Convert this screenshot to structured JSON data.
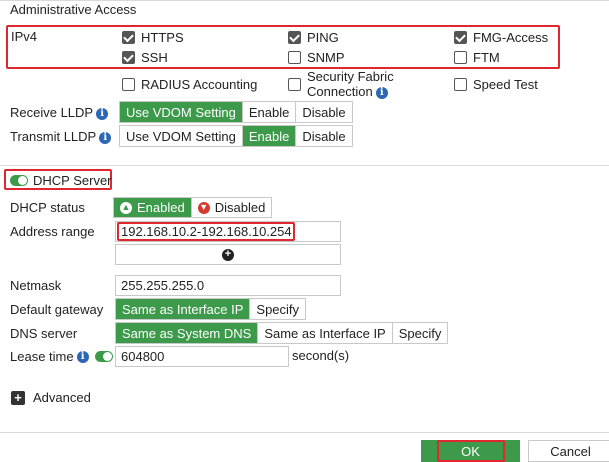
{
  "admin_access": {
    "title": "Administrative Access",
    "ipv4_label": "IPv4",
    "options": [
      {
        "label": "HTTPS",
        "checked": true
      },
      {
        "label": "PING",
        "checked": true
      },
      {
        "label": "FMG-Access",
        "checked": true
      },
      {
        "label": "SSH",
        "checked": true
      },
      {
        "label": "SNMP",
        "checked": false
      },
      {
        "label": "FTM",
        "checked": false
      },
      {
        "label": "RADIUS Accounting",
        "checked": false
      },
      {
        "label": "Security Fabric",
        "label2": "Connection",
        "checked": false
      },
      {
        "label": "Speed Test",
        "checked": false
      }
    ]
  },
  "lldp": {
    "receive_label": "Receive LLDP",
    "transmit_label": "Transmit LLDP",
    "receive_options": [
      "Use VDOM Setting",
      "Enable",
      "Disable"
    ],
    "receive_selected": "Use VDOM Setting",
    "transmit_options": [
      "Use VDOM Setting",
      "Enable",
      "Disable"
    ],
    "transmit_selected": "Enable"
  },
  "dhcp": {
    "title": "DHCP Server",
    "status_label": "DHCP status",
    "enabled_label": "Enabled",
    "disabled_label": "Disabled",
    "address_range_label": "Address range",
    "address_range_value": "192.168.10.2-192.168.10.254",
    "netmask_label": "Netmask",
    "netmask_value": "255.255.255.0",
    "gateway_label": "Default gateway",
    "gateway_options": [
      "Same as Interface IP",
      "Specify"
    ],
    "gateway_selected": "Same as Interface IP",
    "dns_label": "DNS server",
    "dns_options": [
      "Same as System DNS",
      "Same as Interface IP",
      "Specify"
    ],
    "dns_selected": "Same as System DNS",
    "lease_label": "Lease time",
    "lease_value": "604800",
    "lease_unit": "second(s)",
    "advanced_label": "Advanced"
  },
  "footer": {
    "ok_label": "OK",
    "cancel_label": "Cancel"
  },
  "colors": {
    "accent_green": "#3c9a4a",
    "highlight_red": "#e0262e",
    "info_blue": "#2b67b5",
    "disabled_red": "#d33a2c"
  }
}
